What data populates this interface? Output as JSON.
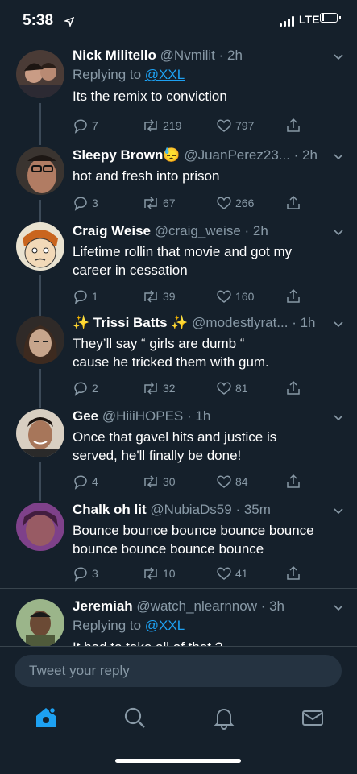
{
  "status": {
    "time": "5:38",
    "network": "LTE"
  },
  "tweets": [
    {
      "name": "Nick Militello",
      "handle": "@Nvmilit",
      "time": "2h",
      "replying_prefix": "Replying to",
      "replying_to": "@XXL",
      "text": [
        "Its the remix to conviction"
      ],
      "replies": "7",
      "retweets": "219",
      "likes": "797"
    },
    {
      "name": "Sleepy Brown",
      "emoji": "😓",
      "handle": "@JuanPerez23...",
      "time": "2h",
      "text": [
        "hot and fresh into prison"
      ],
      "replies": "3",
      "retweets": "67",
      "likes": "266"
    },
    {
      "name": "Craig Weise",
      "handle": "@craig_weise",
      "time": "2h",
      "text": [
        "Lifetime rollin that movie and got my",
        "career in cessation"
      ],
      "replies": "1",
      "retweets": "39",
      "likes": "160"
    },
    {
      "name": "✨ Trissi Batts ✨",
      "handle": "@modestlyrat...",
      "time": "1h",
      "text": [
        "They’ll say “ girls are dumb “",
        "cause he tricked them with gum."
      ],
      "replies": "2",
      "retweets": "32",
      "likes": "81"
    },
    {
      "name": "Gee",
      "handle": "@HiiiHOPES",
      "time": "1h",
      "text": [
        "Once that gavel hits and justice is",
        "served, he'll finally be done!"
      ],
      "replies": "4",
      "retweets": "30",
      "likes": "84"
    },
    {
      "name": "Chalk oh lit",
      "handle": "@NubiaDs59",
      "time": "35m",
      "text": [
        "Bounce bounce bounce bounce bounce",
        "bounce bounce bounce bounce"
      ],
      "replies": "3",
      "retweets": "10",
      "likes": "41"
    },
    {
      "name": "Jeremiah",
      "handle": "@watch_nlearnnow",
      "time": "3h",
      "replying_prefix": "Replying to",
      "replying_to": "@XXL",
      "text": [
        "It had to take all of that ?"
      ]
    }
  ],
  "composer": {
    "placeholder": "Tweet your reply"
  },
  "tabs": [
    {
      "icon": "home-icon",
      "active": true
    },
    {
      "icon": "search-icon",
      "active": false
    },
    {
      "icon": "bell-icon",
      "active": false
    },
    {
      "icon": "mail-icon",
      "active": false
    }
  ],
  "colors": {
    "background": "#15202b",
    "accent": "#1da1f2",
    "muted": "#8899a6",
    "text": "#ffffff"
  }
}
